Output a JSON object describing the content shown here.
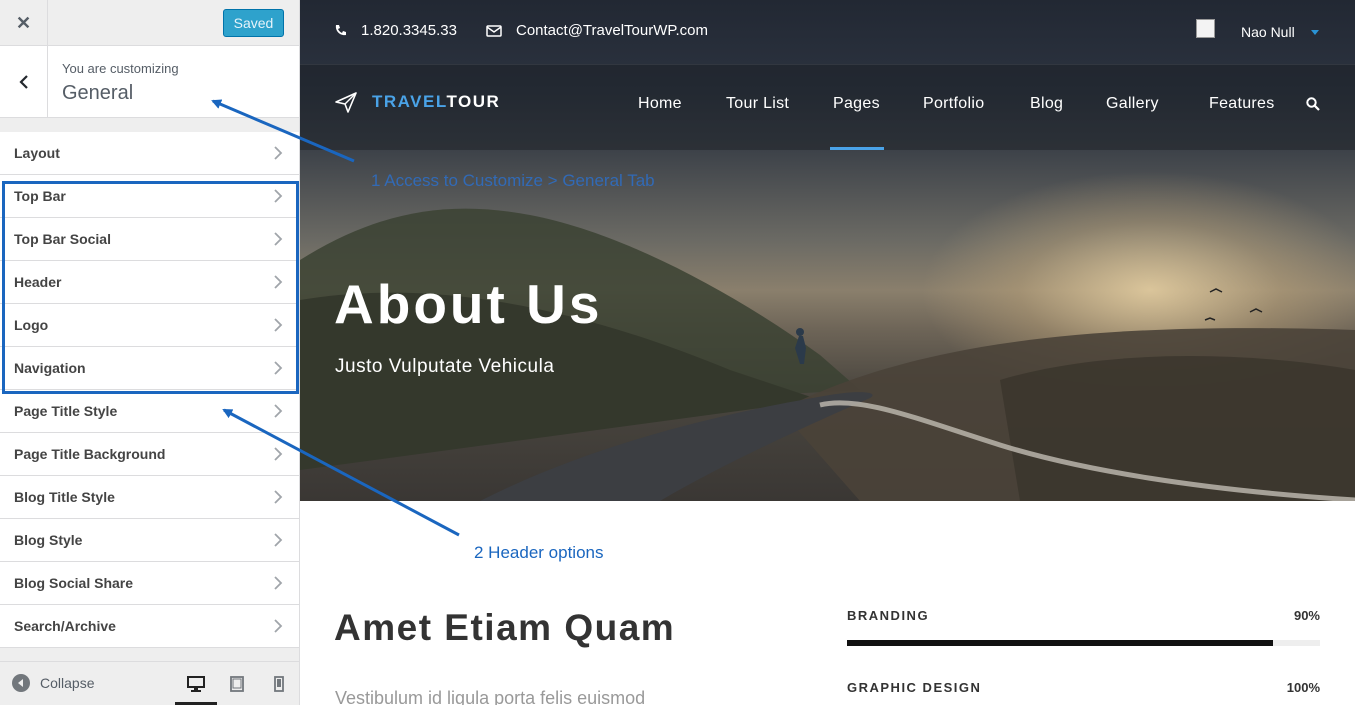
{
  "customizer": {
    "saved_label": "Saved",
    "customizing_label": "You are customizing",
    "section_title": "General",
    "menu_items": [
      {
        "label": "Layout"
      },
      {
        "label": "Top Bar"
      },
      {
        "label": "Top Bar Social"
      },
      {
        "label": "Header"
      },
      {
        "label": "Logo"
      },
      {
        "label": "Navigation"
      },
      {
        "label": "Page Title Style"
      },
      {
        "label": "Page Title Background"
      },
      {
        "label": "Blog Title Style"
      },
      {
        "label": "Blog Style"
      },
      {
        "label": "Blog Social Share"
      },
      {
        "label": "Search/Archive"
      }
    ],
    "collapse_label": "Collapse",
    "devices": [
      "desktop-icon",
      "tablet-icon",
      "mobile-icon"
    ],
    "active_device": "desktop"
  },
  "site": {
    "phone": "1.820.3345.33",
    "email": "Contact@TravelTourWP.com",
    "user_name": "Nao Null",
    "logo_part1": "TRAVEL",
    "logo_part2": "TOUR",
    "nav": [
      {
        "label": "Home"
      },
      {
        "label": "Tour List"
      },
      {
        "label": "Pages"
      },
      {
        "label": "Portfolio"
      },
      {
        "label": "Blog"
      },
      {
        "label": "Gallery"
      },
      {
        "label": "Features"
      }
    ],
    "active_nav": "Pages",
    "hero_title": "About Us",
    "hero_subtitle": "Justo Vulputate Vehicula",
    "content_title": "Amet Etiam Quam",
    "content_text": "Vestibulum id ligula porta felis euismod",
    "skills": [
      {
        "label": "BRANDING",
        "percent_text": "90%",
        "percent": 90
      },
      {
        "label": "GRAPHIC DESIGN",
        "percent_text": "100%",
        "percent": 100
      }
    ]
  },
  "annotations": {
    "note1": "1 Access to Customize > General Tab",
    "note2": "2 Header options"
  },
  "colors": {
    "accent": "#4aa3e8",
    "wp_blue": "#2ea2cc",
    "annotation_blue": "#1a66bf"
  }
}
